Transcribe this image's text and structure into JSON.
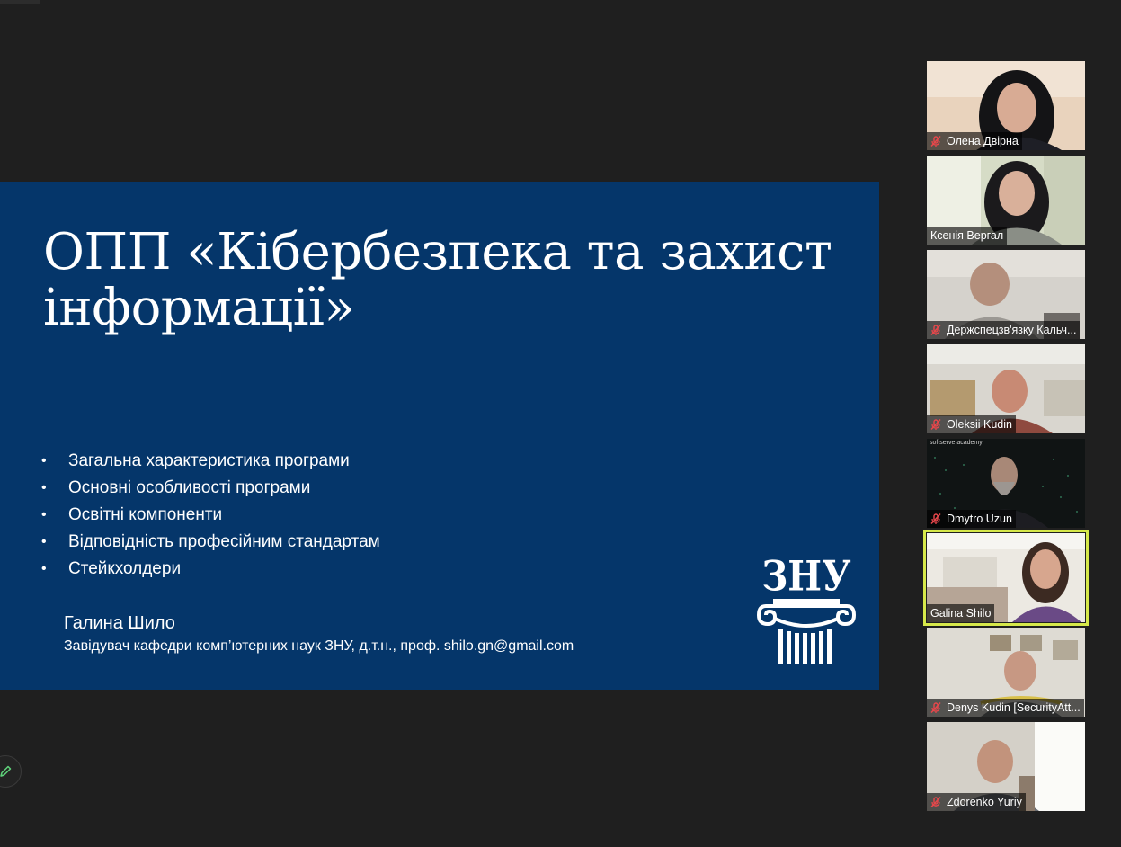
{
  "slide": {
    "title": "ОПП «Кібербезпека та захист інформації»",
    "bullets": [
      "Загальна характеристика програми",
      "Основні особливості програми",
      "Освітні компоненти",
      "Відповідність професійним стандартам",
      "Стейкхолдери"
    ],
    "bullet_symbol": "•",
    "author_name": "Галина Шило",
    "author_details": "Завідувач кафедри комп’ютерних наук ЗНУ, д.т.н., проф.  shilo.gn@gmail.com",
    "logo_text": "ЗНУ",
    "background_color": "#05366a"
  },
  "participants": [
    {
      "name": "Олена Двірна",
      "muted": true
    },
    {
      "name": "Ксенія Вергал",
      "muted": false
    },
    {
      "name": "Держспецзв'язку Кальч...",
      "muted": true
    },
    {
      "name": "Oleksii Kudin",
      "muted": true
    },
    {
      "name": "Dmytro Uzun",
      "muted": true,
      "caption": "softserve academy"
    },
    {
      "name": "Galina Shilo",
      "muted": false,
      "active_speaker": true
    },
    {
      "name": "Denys Kudin [SecurityAtt...",
      "muted": true
    },
    {
      "name": "Zdorenko Yuriy",
      "muted": true
    }
  ],
  "controls": {
    "annotate_icon": "pencil-icon",
    "mic_icon": "muted-mic-icon",
    "active_speaker_color": "#d6e84a"
  }
}
